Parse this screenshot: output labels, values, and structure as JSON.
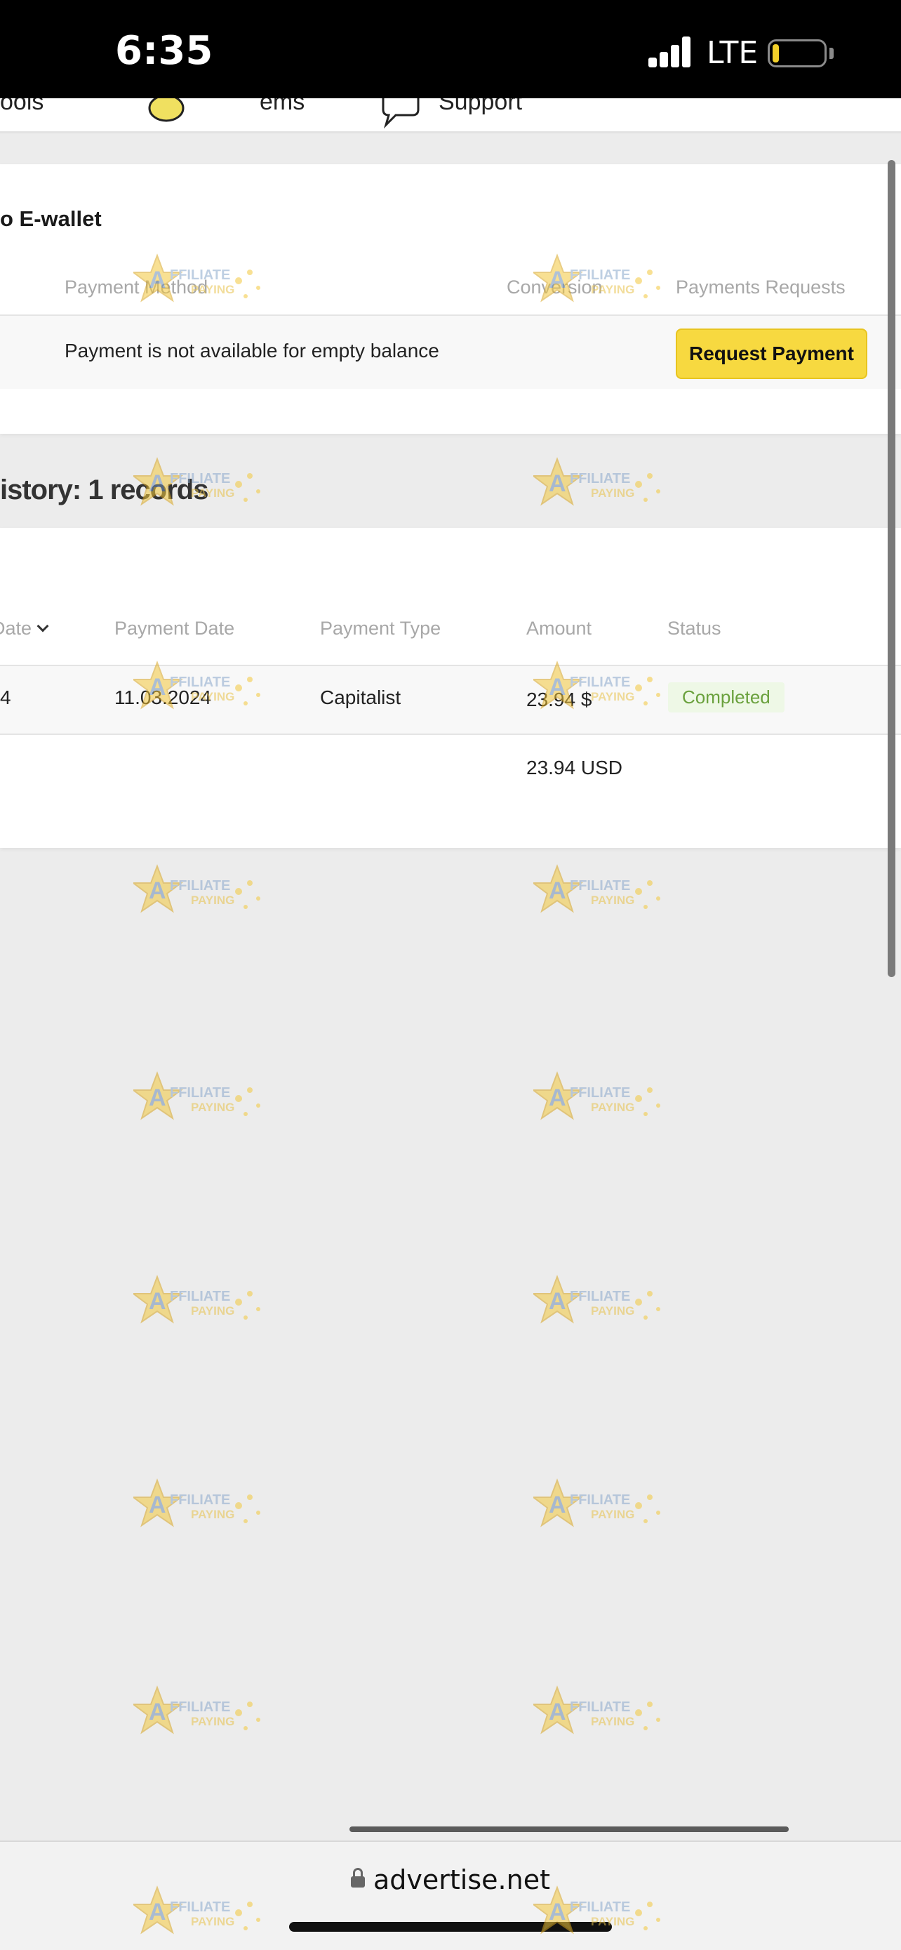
{
  "status_bar": {
    "time": "6:35",
    "network": "LTE",
    "battery_level": 0.12
  },
  "top_nav": {
    "tools_partial": "ools",
    "items_partial": "ems",
    "support_partial": "Support"
  },
  "withdraw_card": {
    "title": "o E-wallet",
    "headers": {
      "payment_method": "Payment Method",
      "conversion": "Conversion",
      "payments_requests": "Payments Requests"
    },
    "row_text": "Payment is not available for empty balance",
    "request_button": "Request Payment"
  },
  "history": {
    "heading": "istory: 1 records",
    "columns": {
      "date": "Date",
      "payment_date": "Payment Date",
      "payment_type": "Payment Type",
      "amount": "Amount",
      "status": "Status"
    },
    "rows": [
      {
        "date": "4",
        "payment_date": "11.03.2024",
        "payment_type": "Capitalist",
        "amount": "23.94 $",
        "status": "Completed"
      }
    ],
    "total": "23.94 USD"
  },
  "browser": {
    "url": "advertise.net"
  },
  "watermark": {
    "line1": "AFFILIATE",
    "line2": "PAYING"
  },
  "colors": {
    "accent_button": "#f7d940",
    "status_completed": "#6aa13d",
    "status_completed_bg": "#eef8e6"
  }
}
